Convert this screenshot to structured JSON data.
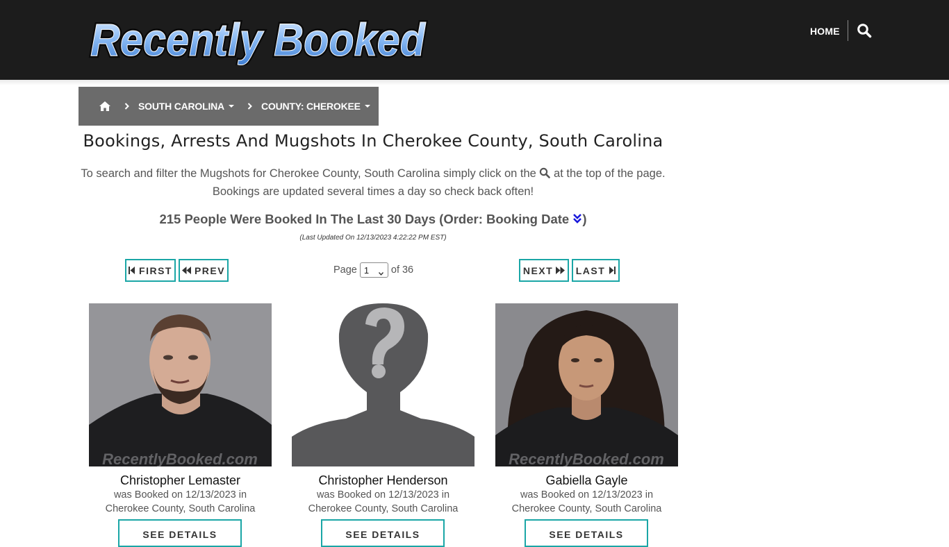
{
  "header": {
    "logo_text": "Recently Booked",
    "nav_home": "HOME",
    "search_icon": "search-icon"
  },
  "breadcrumb": {
    "home_icon": "home-icon",
    "items": [
      {
        "label": "SOUTH CAROLINA"
      },
      {
        "label": "COUNTY: CHEROKEE"
      }
    ]
  },
  "page": {
    "title": "Bookings, Arrests And Mugshots In Cherokee County, South Carolina",
    "intro_before": "To search and filter the Mugshots for Cherokee County, South Carolina simply click on the",
    "intro_after": "at the top of the page. Bookings are updated several times a day so check back often!",
    "count_text": "215 People Were Booked In The Last 30 Days (Order: Booking Date",
    "count_close": ")",
    "last_updated": "(Last Updated On 12/13/2023 4:22:22 PM EST)"
  },
  "pager": {
    "first": "FIRST",
    "prev": "PREV",
    "next": "NEXT",
    "last": "LAST",
    "page_label": "Page",
    "current_page": "1",
    "of_label": "of 36"
  },
  "cards": [
    {
      "name": "Christopher Lemaster",
      "line1": "was Booked on 12/13/2023 in",
      "line2": "Cherokee County, South Carolina",
      "button": "SEE DETAILS",
      "watermark": "RecentlyBooked.com"
    },
    {
      "name": "Christopher Henderson",
      "line1": "was Booked on 12/13/2023 in",
      "line2": "Cherokee County, South Carolina",
      "button": "SEE DETAILS"
    },
    {
      "name": "Gabiella Gayle",
      "line1": "was Booked on 12/13/2023 in",
      "line2": "Cherokee County, South Carolina",
      "button": "SEE DETAILS",
      "watermark": "RecentlyBooked.com"
    }
  ],
  "colors": {
    "header_bg": "#1c1c1c",
    "breadcrumb_bg": "#6b6b6b",
    "accent_teal": "#1aa6a6",
    "logo_blue": "#7fb2f0"
  }
}
